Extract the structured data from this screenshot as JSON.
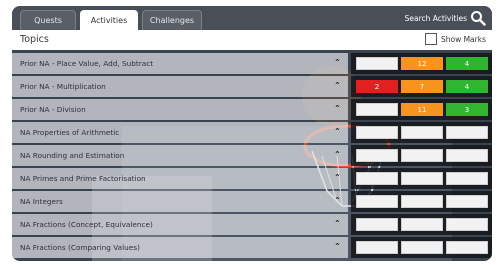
{
  "tabs": [
    {
      "label": "Quests"
    },
    {
      "label": "Activities",
      "active": true
    },
    {
      "label": "Challenges"
    }
  ],
  "search": {
    "label": "Search Activities",
    "icon": "search-icon"
  },
  "topics": {
    "title": "Topics",
    "show_marks_label": "Show Marks",
    "show_marks_checked": false
  },
  "colors": {
    "red": "#e32020",
    "orange": "#f7941d",
    "green": "#2fb52f"
  },
  "rows": [
    {
      "label": "Prior NA - Place Value, Add, Subtract",
      "scores": [
        {
          "text": "",
          "color": "white"
        },
        {
          "text": "12",
          "color": "orange"
        },
        {
          "text": "4",
          "color": "green"
        }
      ]
    },
    {
      "label": "Prior NA - Multiplication",
      "scores": [
        {
          "text": "2",
          "color": "red"
        },
        {
          "text": "7",
          "color": "orange"
        },
        {
          "text": "4",
          "color": "green"
        }
      ]
    },
    {
      "label": "Prior NA - Division",
      "scores": [
        {
          "text": "",
          "color": "white"
        },
        {
          "text": "11",
          "color": "orange"
        },
        {
          "text": "3",
          "color": "green"
        }
      ]
    },
    {
      "label": "NA Properties of Arithmetic",
      "scores": [
        {
          "text": "",
          "color": "white"
        },
        {
          "text": "",
          "color": "white"
        },
        {
          "text": "",
          "color": "white"
        }
      ]
    },
    {
      "label": "NA Rounding and Estimation",
      "scores": [
        {
          "text": "",
          "color": "white"
        },
        {
          "text": "",
          "color": "white"
        },
        {
          "text": "",
          "color": "white"
        }
      ]
    },
    {
      "label": "NA Primes and Prime Factorisation",
      "scores": [
        {
          "text": "",
          "color": "white"
        },
        {
          "text": "",
          "color": "white"
        },
        {
          "text": "",
          "color": "white"
        }
      ]
    },
    {
      "label": "NA Integers",
      "scores": [
        {
          "text": "",
          "color": "white"
        },
        {
          "text": "",
          "color": "white"
        },
        {
          "text": "",
          "color": "white"
        }
      ]
    },
    {
      "label": "NA Fractions (Concept, Equivalence)",
      "scores": [
        {
          "text": "",
          "color": "white"
        },
        {
          "text": "",
          "color": "white"
        },
        {
          "text": "",
          "color": "white"
        }
      ]
    },
    {
      "label": "NA Fractions (Comparing Values)",
      "scores": [
        {
          "text": "",
          "color": "white"
        },
        {
          "text": "",
          "color": "white"
        },
        {
          "text": "",
          "color": "white"
        }
      ]
    }
  ]
}
